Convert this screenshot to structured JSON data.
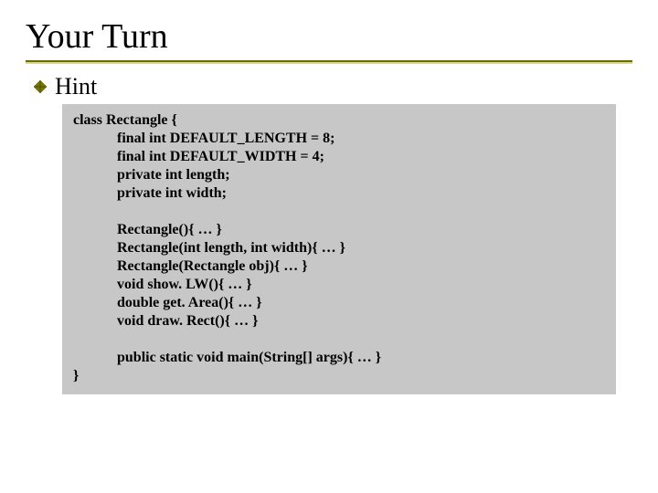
{
  "title": "Your Turn",
  "bullet": "Hint",
  "code": "class Rectangle {\n            final int DEFAULT_LENGTH = 8;\n            final int DEFAULT_WIDTH = 4;\n            private int length;\n            private int width;\n\n            Rectangle(){ … }\n            Rectangle(int length, int width){ … }\n            Rectangle(Rectangle obj){ … }\n            void show. LW(){ … }\n            double get. Area(){ … }\n            void draw. Rect(){ … }\n\n            public static void main(String[] args){ … }\n}"
}
